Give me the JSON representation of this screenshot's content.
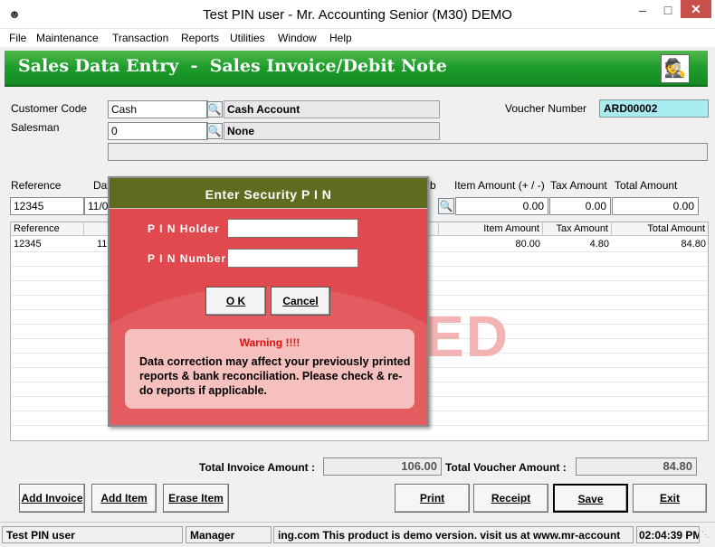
{
  "window": {
    "title": "Test PIN user - Mr. Accounting Senior (M30) DEMO",
    "minimize": "–",
    "maximize": "□",
    "close": "✕",
    "app_icon": "user-icon"
  },
  "menu": [
    "File",
    "Maintenance",
    "Transaction",
    "Reports",
    "Utilities",
    "Window",
    "Help"
  ],
  "header": {
    "title": "Sales Data Entry  -  Sales Invoice/Debit Note",
    "avatar_icon": "user-search-icon",
    "color": "#1d9d2c"
  },
  "form": {
    "customer_code_label": "Customer Code",
    "customer_code": "Cash",
    "customer_name": "Cash Account",
    "salesman_label": "Salesman",
    "salesman": "0",
    "salesman_name": "None",
    "voucher_label": "Voucher Number",
    "voucher_number": "ARD00002"
  },
  "entry_row": {
    "reference_label": "Reference",
    "date_label": "Dat",
    "tb_label": "b",
    "item_amount_label": "Item Amount (+ / -)",
    "tax_amount_label": "Tax Amount",
    "total_amount_label": "Total Amount",
    "reference": "12345",
    "date": "11/0",
    "item_amount": "0.00",
    "tax_amount": "0.00",
    "total_amount": "0.00"
  },
  "grid": {
    "headers": {
      "reference": "Reference",
      "item_amount": "Item Amount",
      "tax_amount": "Tax Amount",
      "total_amount": "Total Amount"
    },
    "rows": [
      {
        "reference": "12345",
        "date": "11,",
        "item_amount": "80.00",
        "tax_amount": "4.80",
        "total_amount": "84.80"
      }
    ],
    "watermark": "ED"
  },
  "totals": {
    "invoice_label": "Total Invoice Amount :",
    "invoice_value": "106.00",
    "voucher_label": "Total  Voucher Amount :",
    "voucher_value": "84.80"
  },
  "buttons": {
    "add_invoice": "Add Invoice",
    "add_item": "Add Item",
    "erase_item": "Erase Item",
    "print": "Print",
    "receipt": "Receipt",
    "save": "Save",
    "exit": "Exit"
  },
  "status": {
    "user": "Test PIN user",
    "role": "Manager",
    "message": "ing.com This product is demo version.  visit us at www.mr-account",
    "time": "02:04:39 PM"
  },
  "dialog": {
    "title": "Enter Security P I N",
    "holder_label": "P I N Holder",
    "number_label": "P I N Number",
    "holder_value": "",
    "number_value": "",
    "ok": "O K",
    "cancel": "Cancel",
    "warning_title": "Warning !!!!",
    "warning_text": "Data correction may affect your previously printed reports & bank reconciliation. Please check & re-do reports if applicable."
  }
}
